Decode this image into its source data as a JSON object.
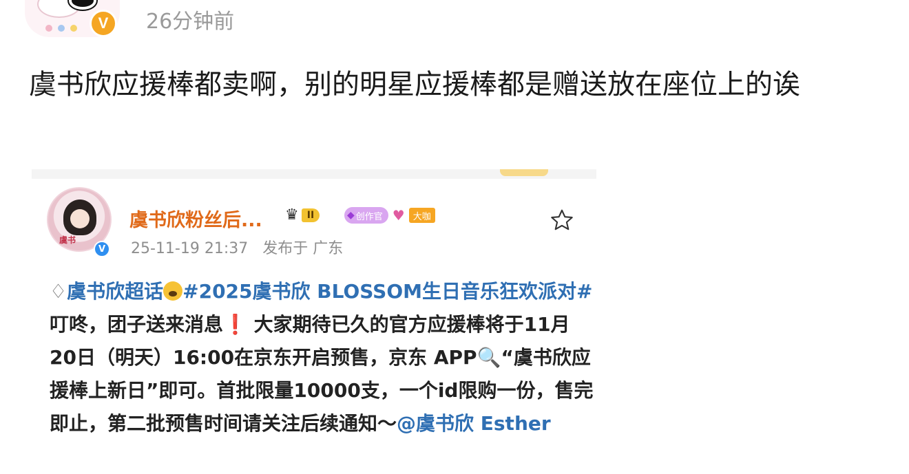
{
  "header": {
    "timestamp": "26分钟前",
    "verified_badge": "V",
    "avatar_icon": "avatar-icon"
  },
  "post": {
    "text": "虞书欣应援棒都卖啊，别的明星应援棒都是赠送放在座位上的诶"
  },
  "embedded_post": {
    "author_name": "虞书欣粉丝后...",
    "level_badge": "II",
    "creator_badge": "创作官",
    "big_badge": "大咖",
    "verified_badge": "V",
    "avatar_label": "虞书",
    "date": "25-11-19 21:37",
    "location": "发布于 广东",
    "body": {
      "topic_link": "虞书欣超话",
      "hashtag": "#2025虞书欣 BLOSSOM生日音乐狂欢派对#",
      "text_1": " 叮咚，团子送来消息",
      "excl": "❗",
      "text_2": " 大家期待已久的官方应援棒将于11月20日（明天）16:00在京东开启预售，京东 APP",
      "search_glyph": "🔍",
      "text_3": "“虞书欣应援棒上新日”即可。首批限量10000支，一个id限购一份，售完即止，第二批预售时间请关注后续通知～",
      "mention": "@虞书欣 Esther"
    }
  }
}
